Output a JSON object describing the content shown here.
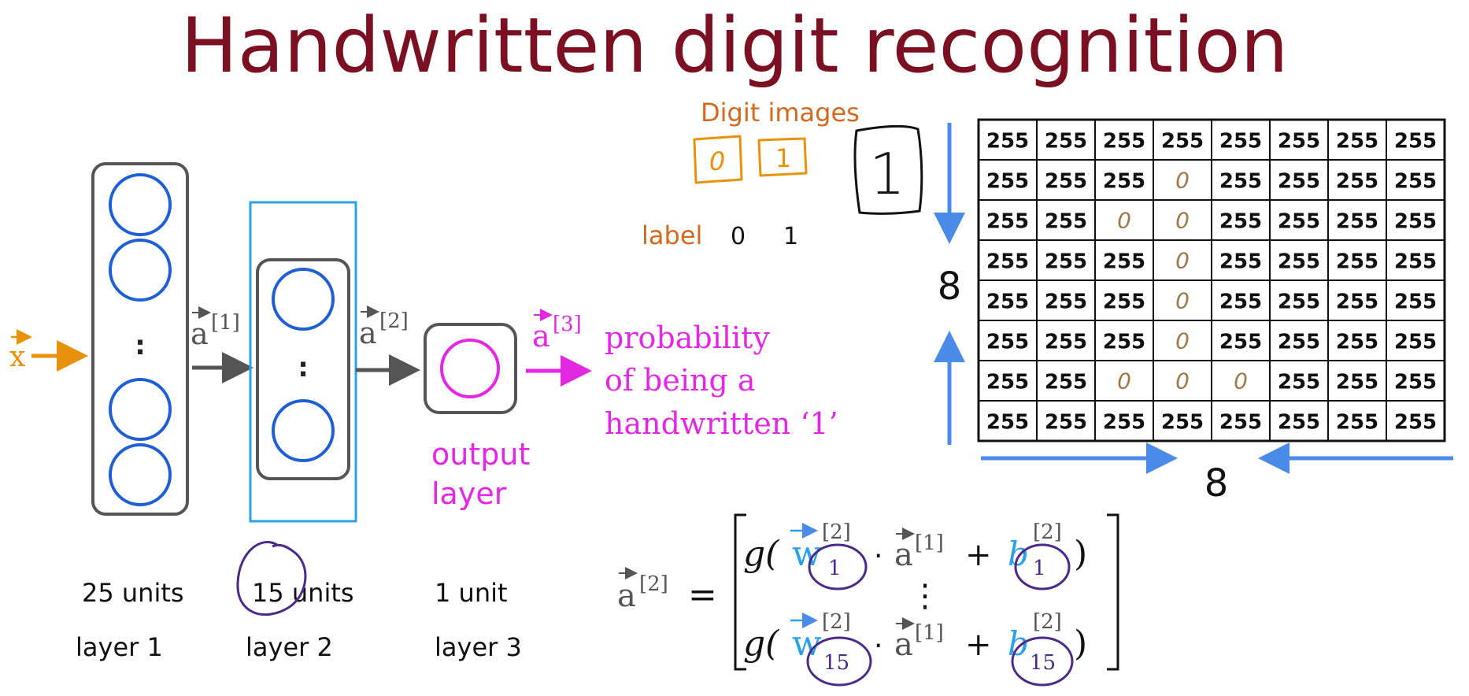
{
  "title": "Handwritten digit recognition",
  "network": {
    "input_label": "x",
    "arrow_labels": [
      {
        "base": "a",
        "sup": "[1]"
      },
      {
        "base": "a",
        "sup": "[2]"
      },
      {
        "base": "a",
        "sup": "[3]"
      }
    ],
    "output_text": [
      "probability",
      "of being a",
      "handwritten ‘1’"
    ],
    "output_layer_label": [
      "output",
      "layer"
    ],
    "layers": [
      {
        "units": "25 units",
        "name": "layer 1"
      },
      {
        "units": "15 units",
        "name": "layer 2"
      },
      {
        "units": "1 unit",
        "name": "layer 3"
      }
    ],
    "ellipsis": ":"
  },
  "digit_images": {
    "title": "Digit images",
    "digits": [
      "0",
      "1"
    ],
    "label_word": "label",
    "labels": [
      "0",
      "1"
    ],
    "sample_digit": "1"
  },
  "pixel_grid": {
    "rows": [
      [
        "255",
        "255",
        "255",
        "255",
        "255",
        "255",
        "255",
        "255"
      ],
      [
        "255",
        "255",
        "255",
        "0",
        "255",
        "255",
        "255",
        "255"
      ],
      [
        "255",
        "255",
        "0",
        "0",
        "255",
        "255",
        "255",
        "255"
      ],
      [
        "255",
        "255",
        "255",
        "0",
        "255",
        "255",
        "255",
        "255"
      ],
      [
        "255",
        "255",
        "255",
        "0",
        "255",
        "255",
        "255",
        "255"
      ],
      [
        "255",
        "255",
        "255",
        "0",
        "255",
        "255",
        "255",
        "255"
      ],
      [
        "255",
        "255",
        "0",
        "0",
        "0",
        "255",
        "255",
        "255"
      ],
      [
        "255",
        "255",
        "255",
        "255",
        "255",
        "255",
        "255",
        "255"
      ]
    ],
    "height_label": "8",
    "width_label": "8"
  },
  "equation": {
    "lhs": {
      "base": "a",
      "sup": "[2]"
    },
    "equals": "=",
    "rows": [
      {
        "g": "g(",
        "w": "w",
        "w_sup": "[2]",
        "w_sub": "1",
        "dot": "·",
        "a": "a",
        "a_sup": "[1]",
        "plus": "+",
        "b": "b",
        "b_sup": "[2]",
        "b_sub": "1",
        "close": ")"
      },
      {
        "g": "g(",
        "w": "w",
        "w_sup": "[2]",
        "w_sub": "15",
        "dot": "·",
        "a": "a",
        "a_sup": "[1]",
        "plus": "+",
        "b": "b",
        "b_sup": "[2]",
        "b_sub": "15",
        "close": ")"
      }
    ],
    "vdots": "⋮"
  },
  "colors": {
    "title": "#7a1022",
    "input": "#e8920c",
    "neuron": "#1f5fd6",
    "layer_box": "#555555",
    "highlight": "#29a3e6",
    "output": "#e328e3",
    "orange_label": "#d2691e",
    "annotation": "#4b2a8a",
    "arrow_blue": "#4a8ae8",
    "w_blue": "#2aa0e8",
    "zero_brown": "#9c7a4e"
  }
}
